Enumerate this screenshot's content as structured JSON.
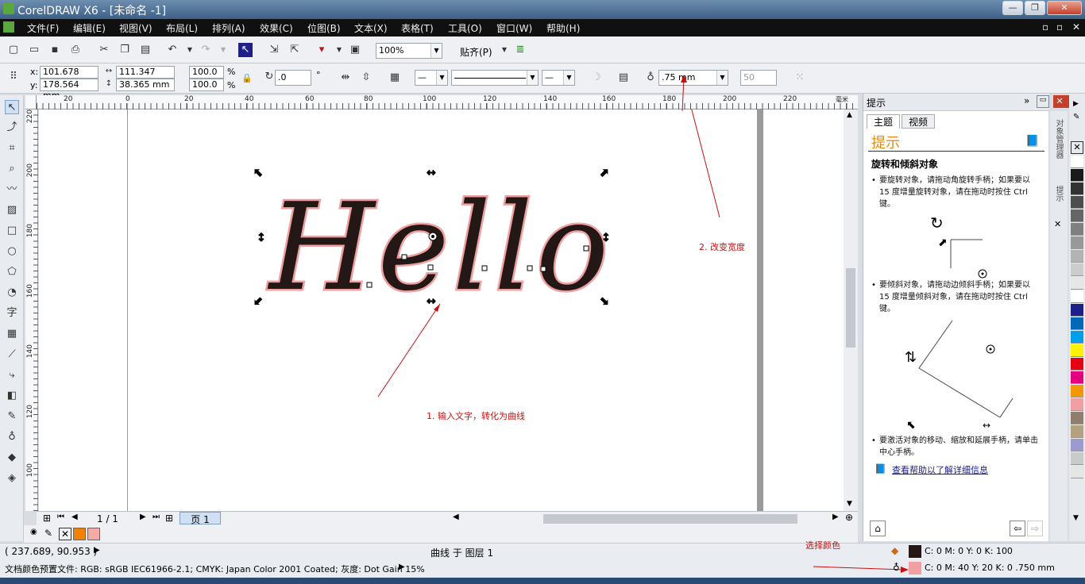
{
  "window": {
    "title": "CorelDRAW X6 - [未命名 -1]",
    "controls": [
      "—",
      "❐",
      "✕"
    ]
  },
  "menu": [
    "文件(F)",
    "编辑(E)",
    "视图(V)",
    "布局(L)",
    "排列(A)",
    "效果(C)",
    "位图(B)",
    "文本(X)",
    "表格(T)",
    "工具(O)",
    "窗口(W)",
    "帮助(H)"
  ],
  "toolbar": {
    "zoom": "100%",
    "snap": "贴齐(P)"
  },
  "props": {
    "x_label": "x:",
    "x": "101.678 mm",
    "y_label": "y:",
    "y": "178.564 mm",
    "w": "111.347 mm",
    "h": "38.365 mm",
    "sx": "100.0",
    "sy": "100.0",
    "pct": "%",
    "rotate": ".0",
    "deg": "°",
    "outline_width": ".75 mm",
    "miter": "50"
  },
  "ruler": {
    "h_ticks": [
      "20",
      "0",
      "20",
      "40",
      "60",
      "80",
      "100",
      "120",
      "140",
      "160",
      "180",
      "200",
      "220"
    ],
    "v_ticks": [
      "220",
      "200",
      "180",
      "160",
      "140",
      "120",
      "100"
    ],
    "unit": "毫米"
  },
  "canvas": {
    "art_text": "Hello"
  },
  "annotations": {
    "a1": "1. 输入文字，转化为曲线",
    "a2": "2. 改变宽度",
    "a3": "选择颜色"
  },
  "pages": {
    "counter": "1 / 1",
    "tab": "页 1"
  },
  "docker": {
    "title": "提示",
    "tabs": [
      "主题",
      "视频"
    ],
    "heading": "提示",
    "subtitle": "旋转和倾斜对象",
    "bullet1": "要旋转对象，请拖动角旋转手柄；如果要以 15 度增量旋转对象，请在拖动时按住 Ctrl 键。",
    "bullet2": "要倾斜对象，请拖动边倾斜手柄；如果要以 15 度增量倾斜对象，请在拖动时按住 Ctrl 键。",
    "bullet3": "要激活对象的移动、缩放和延展手柄，请单击中心手柄。",
    "link": "查看帮助以了解详细信息",
    "vtabs": [
      "对象管理器",
      "提示"
    ]
  },
  "status": {
    "coords": "( 237.689, 90.953 )",
    "object": "曲线 于 图层 1",
    "fill": "C: 0 M: 0 Y: 0 K: 100",
    "outline": "C: 0 M: 40 Y: 20 K: 0  .750 mm",
    "profile": "文档颜色预置文件: RGB: sRGB IEC61966-2.1; CMYK: Japan Color 2001 Coated; 灰度: Dot Gain 15%"
  },
  "colors": {
    "fill": "#231815",
    "outline": "#f0a0a0",
    "palette": [
      "#ffffff",
      "#1a1a1a",
      "#333333",
      "#4d4d4d",
      "#666666",
      "#808080",
      "#999999",
      "#b3b3b3",
      "#cccccc",
      "#e6e6e6",
      "#ffffff",
      "#1d2088",
      "#0068b7",
      "#00a0e9",
      "#fff100",
      "#e60012",
      "#e4007f",
      "#f39800",
      "#f0a0a0",
      "#8f7e6b",
      "#b3a27f",
      "#9d9ad0",
      "#c9caca",
      "#e5e5e5"
    ]
  }
}
